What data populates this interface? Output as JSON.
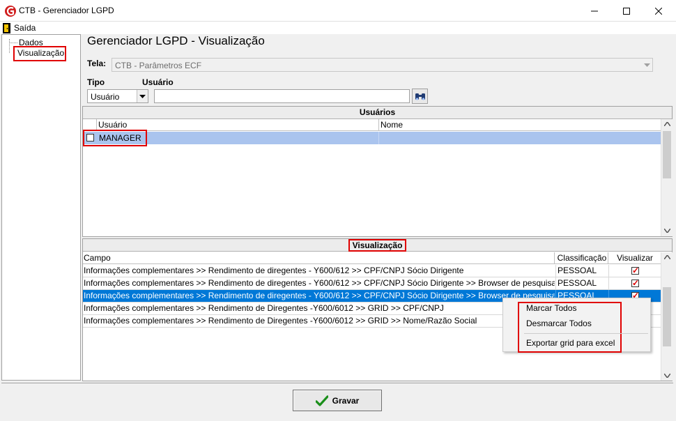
{
  "window": {
    "title": "CTB - Gerenciador LGPD",
    "buttons": [
      "minimize",
      "maximize",
      "close"
    ]
  },
  "menu": {
    "exit_label": "Saída"
  },
  "tree": {
    "items": [
      "Dados",
      "Visualização"
    ],
    "selected": "Visualização"
  },
  "page": {
    "heading": "Gerenciador LGPD - Visualização"
  },
  "form": {
    "tela_label": "Tela:",
    "tela_value": "CTB - Parâmetros ECF",
    "tipo_label": "Tipo",
    "tipo_value": "Usuário",
    "usuario_label": "Usuário",
    "usuario_value": ""
  },
  "users": {
    "caption": "Usuários",
    "columns": [
      "Usuário",
      "Nome"
    ],
    "rows": [
      {
        "usuario": "MANAGER",
        "nome": "",
        "checked": false
      }
    ]
  },
  "visualizacao": {
    "caption": "Visualização",
    "columns": [
      "Campo",
      "Classificação",
      "Visualizar"
    ],
    "rows": [
      {
        "campo": "Informações complementares >> Rendimento de diregentes - Y600/612 >> CPF/CNPJ Sócio Dirigente",
        "classificacao": "PESSOAL",
        "visualizar": true
      },
      {
        "campo": "Informações complementares >> Rendimento de diregentes - Y600/612 >> CPF/CNPJ Sócio Dirigente >> Browser de pesquisa >> CPF/CNPJ",
        "classificacao": "PESSOAL",
        "visualizar": true
      },
      {
        "campo": "Informações complementares >> Rendimento de diregentes - Y600/612 >> CPF/CNPJ Sócio Dirigente >> Browser de pesquisa >> Nome/Ra",
        "classificacao": "PESSOAL",
        "visualizar": true
      },
      {
        "campo": "Informações complementares >> Rendimento de Diregentes -Y600/6012 >> GRID >> CPF/CNPJ",
        "classificacao": "",
        "visualizar": false
      },
      {
        "campo": "Informações complementares >> Rendimento de Diregentes -Y600/6012 >> GRID >> Nome/Razão Social",
        "classificacao": "",
        "visualizar": false
      }
    ],
    "selected_row": 2
  },
  "context_menu": {
    "items": [
      "Marcar Todos",
      "Desmarcar Todos",
      "Exportar grid para excel"
    ]
  },
  "footer": {
    "save_label": "Gravar"
  },
  "colors": {
    "selection": "#0078d7",
    "highlight_border": "#e00000",
    "user_row": "#aac4ee",
    "check_green": "#1a8f1a"
  }
}
